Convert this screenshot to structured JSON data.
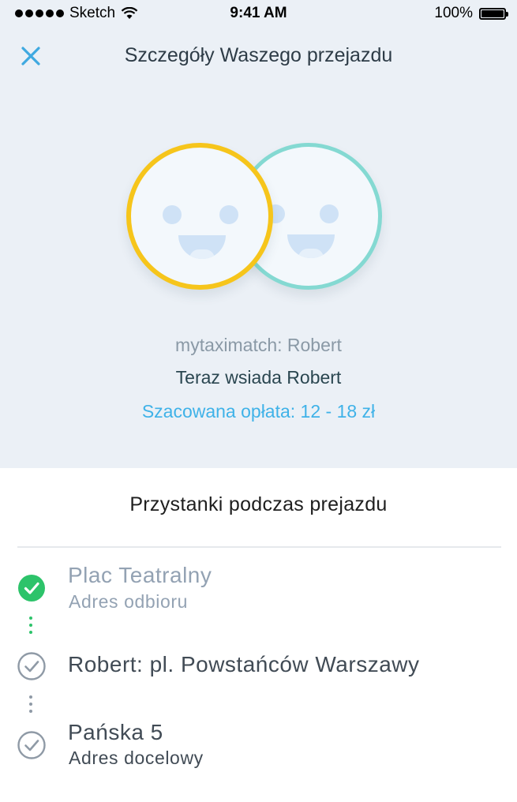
{
  "status_bar": {
    "carrier": "Sketch",
    "time": "9:41 AM",
    "battery": "100%"
  },
  "header": {
    "close_icon": "close-icon",
    "title": "Szczegóły Waszego przejazdu"
  },
  "match_card": {
    "match_text": "mytaximatch: Robert",
    "status_text": "Teraz wsiada Robert",
    "fare_text": "Szacowana opłata: 12 - 18 zł",
    "colors": {
      "passenger_ring": "#f6c51b",
      "match_ring": "#84d9d2",
      "fare": "#3fb2e8"
    }
  },
  "stops": {
    "title": "Przystanki podczas prejazdu",
    "items": [
      {
        "name": "Plac Teatralny",
        "subtitle": "Adres odbioru",
        "state": "done",
        "icon": "check-filled-icon"
      },
      {
        "name": "Robert: pl. Powstańców Warszawy",
        "state": "pending",
        "icon": "check-outline-icon"
      },
      {
        "name": "Pańska 5",
        "subtitle": "Adres docelowy",
        "state": "pending",
        "icon": "check-outline-icon"
      }
    ],
    "colors": {
      "done": "#2dc36a",
      "pending": "#8f9aa6"
    }
  }
}
